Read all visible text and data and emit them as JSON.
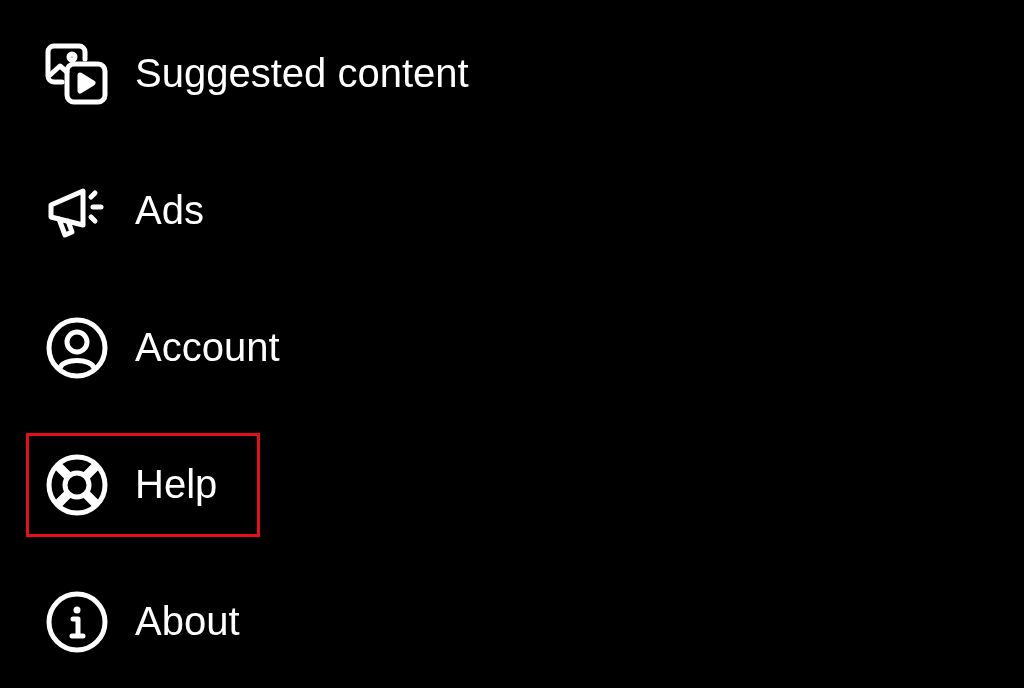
{
  "menu": [
    {
      "kind": "media",
      "label": "Suggested content",
      "highlighted": false
    },
    {
      "kind": "megaphone",
      "label": "Ads",
      "highlighted": false
    },
    {
      "kind": "person",
      "label": "Account",
      "highlighted": false
    },
    {
      "kind": "lifebuoy",
      "label": "Help",
      "highlighted": true
    },
    {
      "kind": "info",
      "label": "About",
      "highlighted": false
    }
  ]
}
